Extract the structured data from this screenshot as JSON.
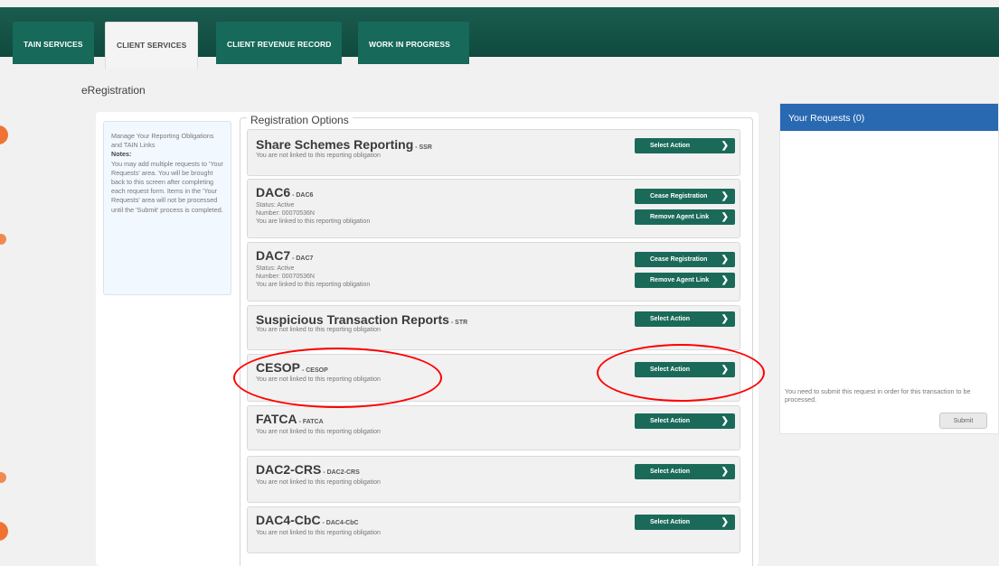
{
  "tabs": [
    {
      "label": "TAIN SERVICES"
    },
    {
      "label": "CLIENT SERVICES"
    },
    {
      "label": "CLIENT REVENUE RECORD"
    },
    {
      "label": "WORK IN PROGRESS"
    }
  ],
  "page_title": "eRegistration",
  "notes": {
    "intro": "Manage Your Reporting Obligations and TAIN Links",
    "title": "Notes:",
    "body": "You may add multiple requests to 'Your Requests' area. You will be brought back to this screen after completing each request form. Items in the 'Your Requests' area will not be processed until the 'Submit' process is completed."
  },
  "registration_options": {
    "legend": "Registration Options",
    "items": [
      {
        "title": "Share Schemes Reporting",
        "code": " - SSR",
        "lines": [
          "You are not linked to this reporting obligation"
        ],
        "buttons": [
          "Select Action"
        ]
      },
      {
        "title": "DAC6",
        "code": " - DAC6",
        "lines": [
          "Status: Active",
          "Number: 00070536N",
          "You are linked to this reporting obligation"
        ],
        "buttons": [
          "Cease Registration",
          "Remove Agent Link"
        ]
      },
      {
        "title": "DAC7",
        "code": " - DAC7",
        "lines": [
          "Status: Active",
          "Number: 00070536N",
          "You are linked to this reporting obligation"
        ],
        "buttons": [
          "Cease Registration",
          "Remove Agent Link"
        ]
      },
      {
        "title": "Suspicious Transaction Reports",
        "code": " - STR",
        "lines": [
          "You are not linked to this reporting obligation"
        ],
        "buttons": [
          "Select Action"
        ]
      },
      {
        "title": "CESOP",
        "code": " - CESOP",
        "lines": [
          "You are not linked to this reporting obligation"
        ],
        "buttons": [
          "Select Action"
        ]
      },
      {
        "title": "FATCA",
        "code": " - FATCA",
        "lines": [
          "You are not linked to this reporting obligation"
        ],
        "buttons": [
          "Select Action"
        ]
      },
      {
        "title": "DAC2-CRS",
        "code": " - DAC2-CRS",
        "lines": [
          "You are not linked to this reporting obligation"
        ],
        "buttons": [
          "Select Action"
        ]
      },
      {
        "title": "DAC4-CbC",
        "code": " - DAC4-CbC",
        "lines": [
          "You are not linked to this reporting obligation"
        ],
        "buttons": [
          "Select Action"
        ]
      }
    ]
  },
  "requests": {
    "title": "Your Requests (0)",
    "note": "You need to submit this request in order for this transaction to be processed.",
    "submit": "Submit"
  },
  "colors": {
    "nav_green": "#0f4a3e",
    "button_green": "#1b6a59",
    "request_blue": "#2869b2",
    "annotation_red": "#ff0000",
    "left_mark_orange": "#f1651e"
  },
  "icons": [
    "chevron-right-icon"
  ]
}
